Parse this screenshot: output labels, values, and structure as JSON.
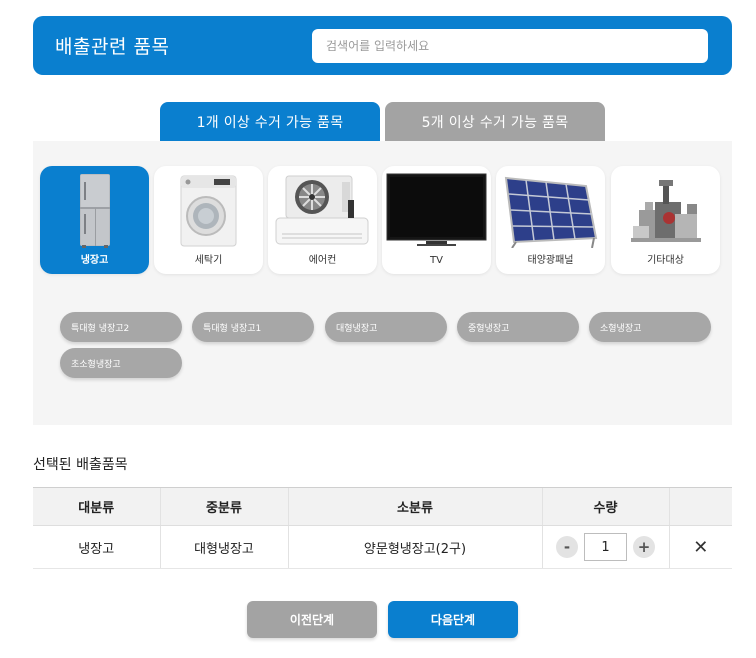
{
  "header": {
    "title": "배출관련 품목",
    "search_placeholder": "검색어를 입력하세요"
  },
  "tabs": [
    {
      "label": "1개 이상 수거 가능 품목",
      "active": true
    },
    {
      "label": "5개 이상 수거 가능 품목",
      "active": false
    }
  ],
  "categories": [
    {
      "label": "냉장고",
      "icon": "refrigerator-icon",
      "active": true
    },
    {
      "label": "세탁기",
      "icon": "washing-machine-icon",
      "active": false
    },
    {
      "label": "에어컨",
      "icon": "air-conditioner-icon",
      "active": false
    },
    {
      "label": "TV",
      "icon": "tv-icon",
      "active": false
    },
    {
      "label": "태양광패널",
      "icon": "solar-panel-icon",
      "active": false
    },
    {
      "label": "기타대상",
      "icon": "misc-appliances-icon",
      "active": false
    }
  ],
  "subitems": [
    "특대형 냉장고2",
    "특대형 냉장고1",
    "대형냉장고",
    "중형냉장고",
    "소형냉장고",
    "초소형냉장고"
  ],
  "selected": {
    "title": "선택된 배출품목",
    "columns": [
      "대분류",
      "중분류",
      "소분류",
      "수량"
    ],
    "rows": [
      {
        "major": "냉장고",
        "middle": "대형냉장고",
        "minor": "양문형냉장고(2구)",
        "qty": "1"
      }
    ],
    "minus": "-",
    "plus": "+",
    "delete": "✕"
  },
  "buttons": {
    "prev": "이전단계",
    "next": "다음단계"
  },
  "colors": {
    "primary": "#0a7fcf",
    "inactive": "#a3a3a3",
    "panel": "#f5f5f5"
  }
}
